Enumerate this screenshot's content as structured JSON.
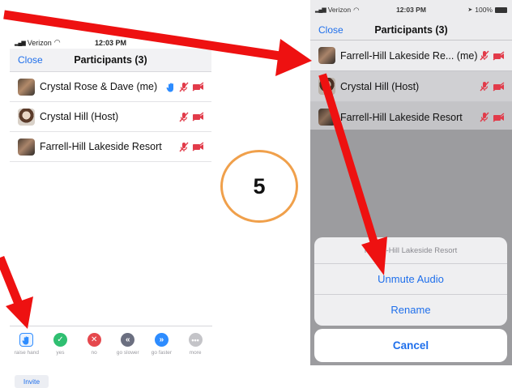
{
  "left_phone": {
    "status": {
      "carrier": "Verizon",
      "time": "12:03 PM"
    },
    "nav": {
      "close_label": "Close",
      "title": "Participants (3)"
    },
    "participants": [
      {
        "name": "Crystal Rose & Dave (me)",
        "hand_raised": true,
        "audio": "muted",
        "video": "off",
        "avatar": "couple-photo"
      },
      {
        "name": "Crystal Hill (Host)",
        "hand_raised": false,
        "audio": "muted",
        "video": "off",
        "avatar": "woman-photo"
      },
      {
        "name": "Farrell-Hill Lakeside Resort",
        "hand_raised": false,
        "audio": "muted",
        "video": "off",
        "avatar": "couple-photo"
      }
    ],
    "reactions": [
      {
        "label": "raise hand",
        "icon": "raise-hand-icon",
        "color": "#2d8cff"
      },
      {
        "label": "yes",
        "icon": "check-icon",
        "color": "#2fbf71"
      },
      {
        "label": "no",
        "icon": "x-icon",
        "color": "#e5484d"
      },
      {
        "label": "go slower",
        "icon": "double-chevron-left-icon",
        "color": "#6b6f80"
      },
      {
        "label": "go faster",
        "icon": "double-chevron-right-icon",
        "color": "#2d8cff"
      },
      {
        "label": "more",
        "icon": "more-dots-icon",
        "color": "#c4c4c8"
      }
    ],
    "invite_label": "Invite"
  },
  "step_badge": {
    "number": "5",
    "ring_color": "#f0a04b"
  },
  "right_phone": {
    "status": {
      "carrier": "Verizon",
      "time": "12:03 PM",
      "battery": "100%"
    },
    "nav": {
      "close_label": "Close",
      "title": "Participants (3)"
    },
    "participants": [
      {
        "name": "Farrell-Hill Lakeside Re... (me)",
        "audio": "muted",
        "video": "off"
      },
      {
        "name": "Crystal Hill (Host)",
        "audio": "muted",
        "video": "off"
      },
      {
        "name": "Farrell-Hill Lakeside Resort",
        "audio": "muted",
        "video": "off"
      }
    ],
    "action_sheet": {
      "header": "Farrell-Hill Lakeside Resort",
      "items": [
        "Unmute Audio",
        "Rename"
      ],
      "cancel_label": "Cancel"
    }
  },
  "colors": {
    "accent": "#1f6feb",
    "muted_red": "#e23b4a",
    "arrow_red": "#ee1111"
  }
}
